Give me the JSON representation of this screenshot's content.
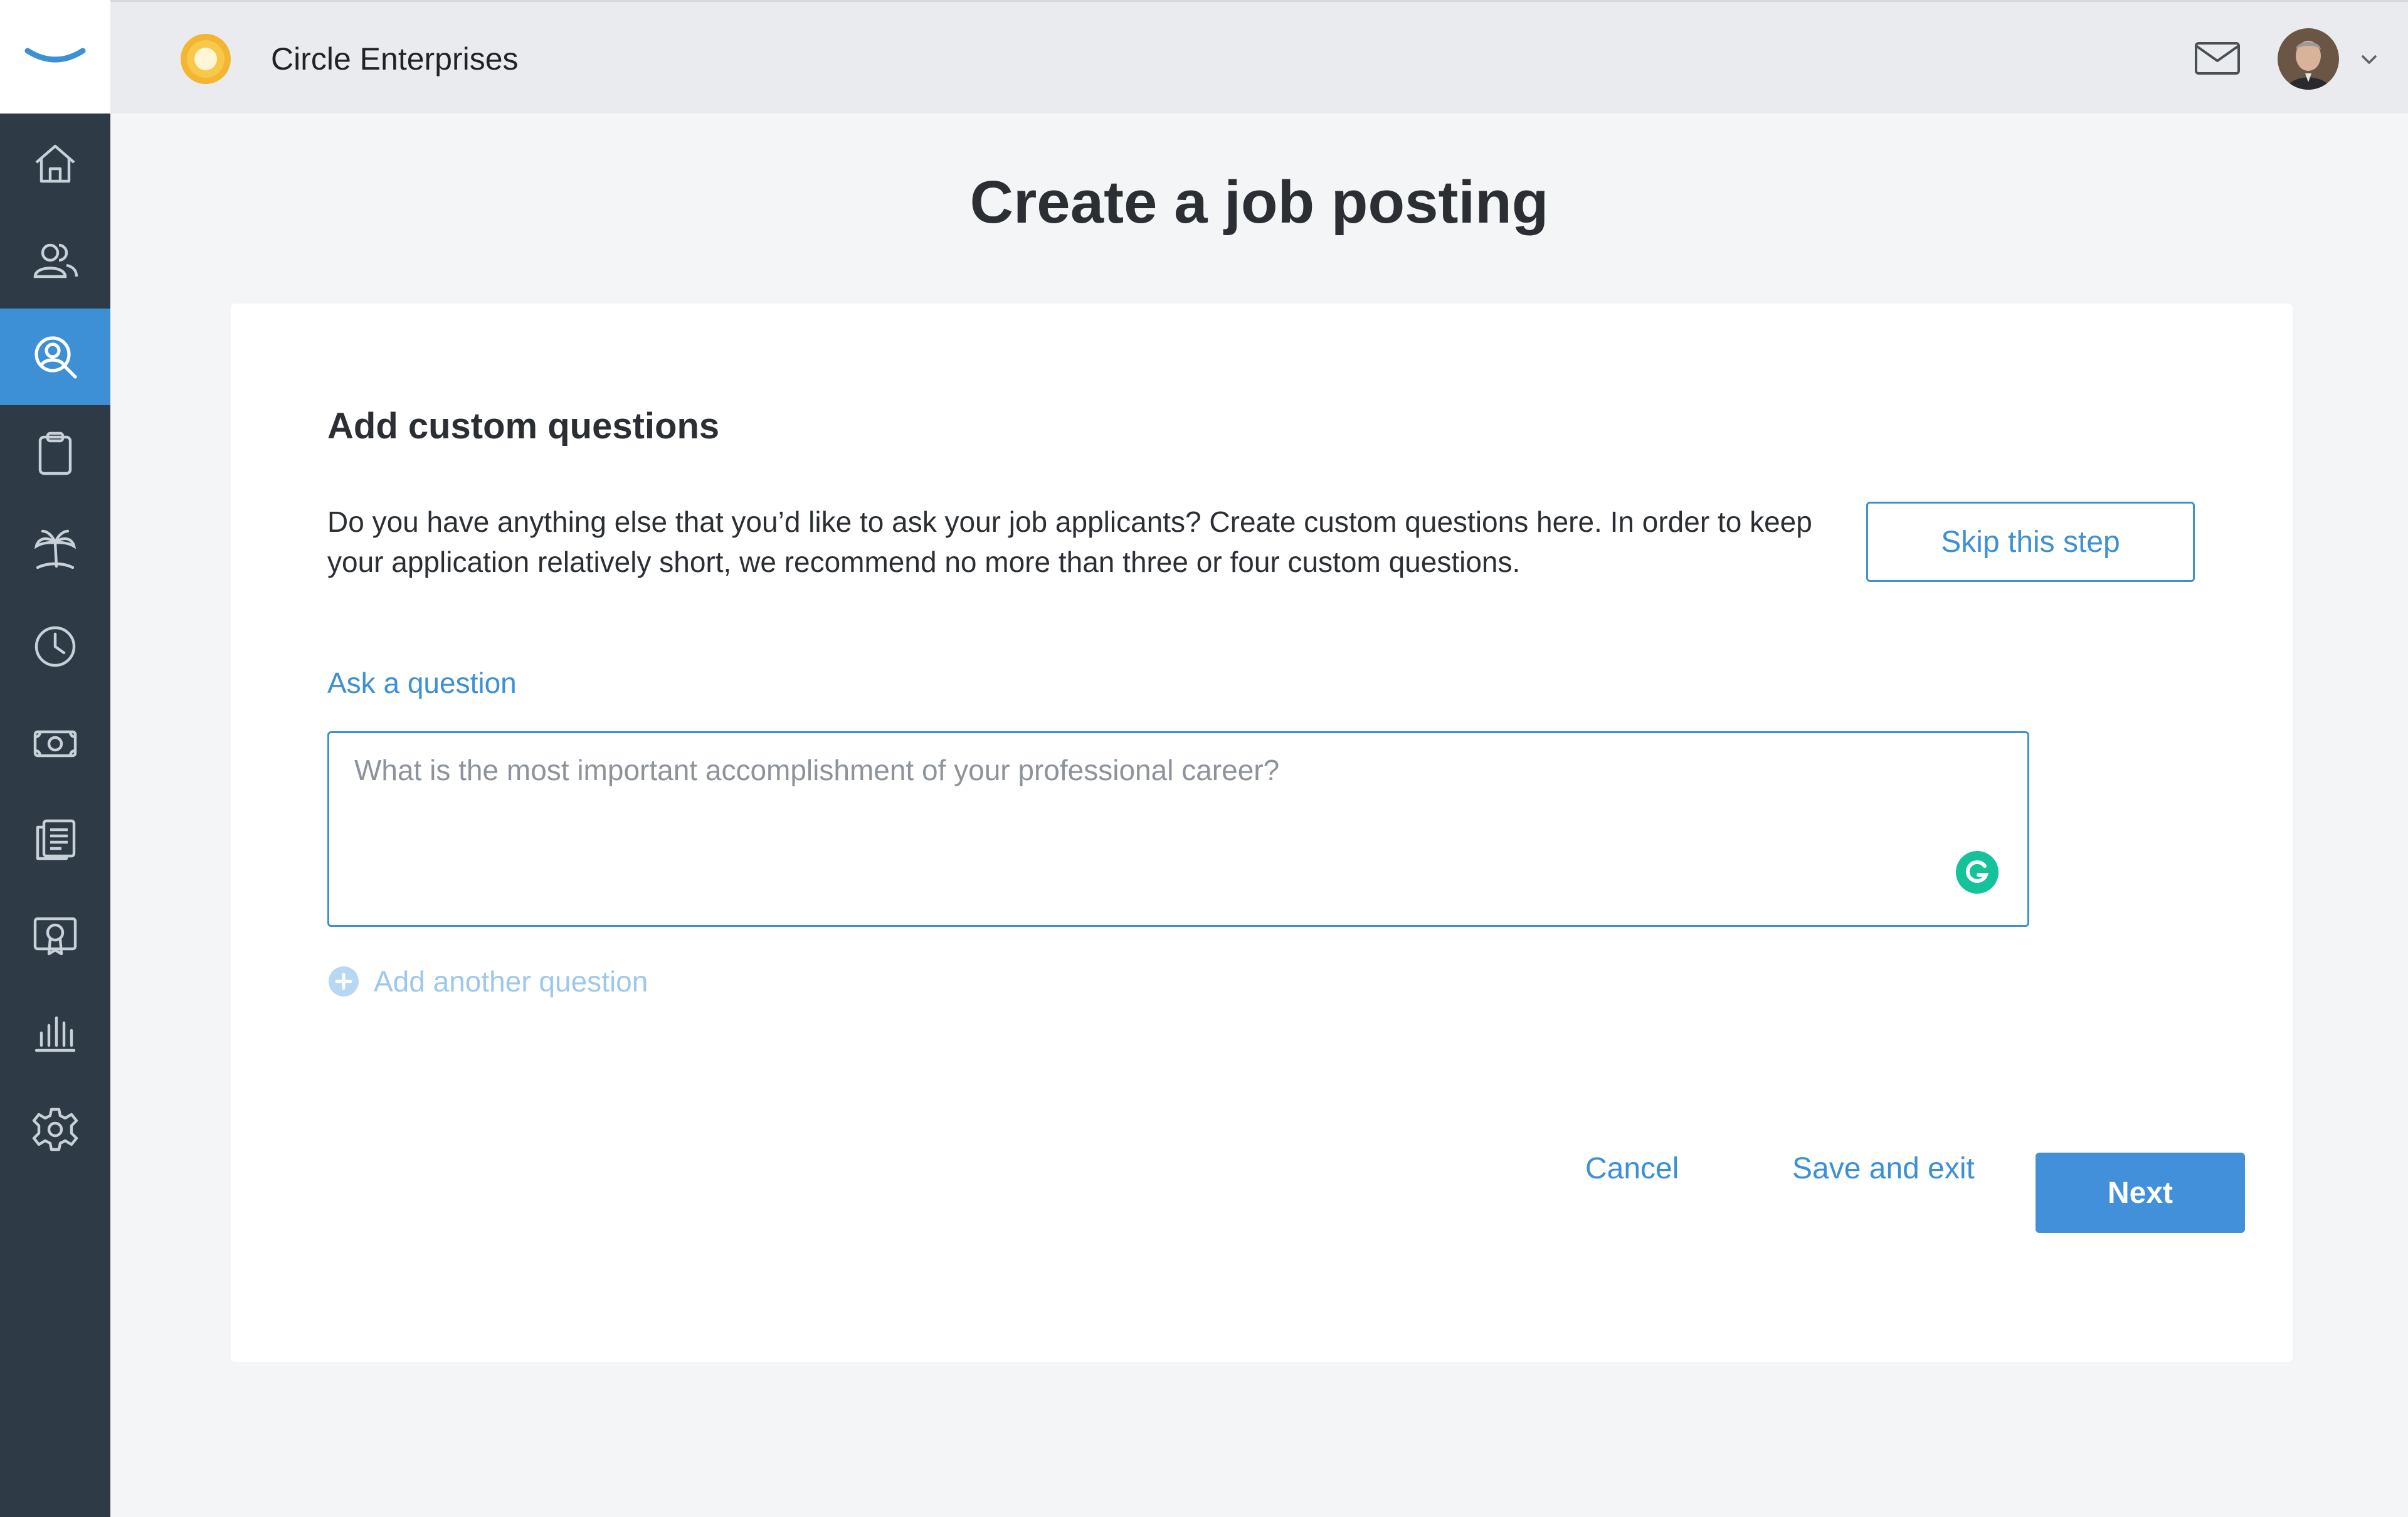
{
  "colors": {
    "accent": "#3d8fd6",
    "sidebar_bg": "#2e3a46",
    "primary_button": "#4290da",
    "muted_link": "#9dc8ec",
    "grammarly": "#15c39a"
  },
  "sidebar": {
    "logo_icon": "smile-logo-icon",
    "items": [
      {
        "icon": "home-icon",
        "active": false
      },
      {
        "icon": "people-icon",
        "active": false
      },
      {
        "icon": "recruiting-search-icon",
        "active": true
      },
      {
        "icon": "clipboard-icon",
        "active": false
      },
      {
        "icon": "palm-tree-icon",
        "active": false
      },
      {
        "icon": "clock-icon",
        "active": false
      },
      {
        "icon": "money-icon",
        "active": false
      },
      {
        "icon": "documents-icon",
        "active": false
      },
      {
        "icon": "certificate-icon",
        "active": false
      },
      {
        "icon": "bar-chart-icon",
        "active": false
      },
      {
        "icon": "gear-icon",
        "active": false
      }
    ]
  },
  "header": {
    "company_name": "Circle Enterprises",
    "mail_icon": "mail-icon",
    "avatar_icon": "user-avatar",
    "menu_icon": "chevron-down-icon"
  },
  "page": {
    "title": "Create a job posting"
  },
  "card": {
    "section_title": "Add custom questions",
    "description": "Do you have anything else that you’d like to ask your job applicants? Create custom questions here. In order to keep your application relatively short, we recommend no more than three or four custom questions.",
    "skip_label": "Skip this step",
    "question_label": "Ask a question",
    "question_placeholder": "What is the most important accomplishment of your professional career?",
    "question_value": "",
    "add_question_label": "Add another question",
    "cancel_label": "Cancel",
    "save_exit_label": "Save and exit",
    "next_label": "Next"
  }
}
